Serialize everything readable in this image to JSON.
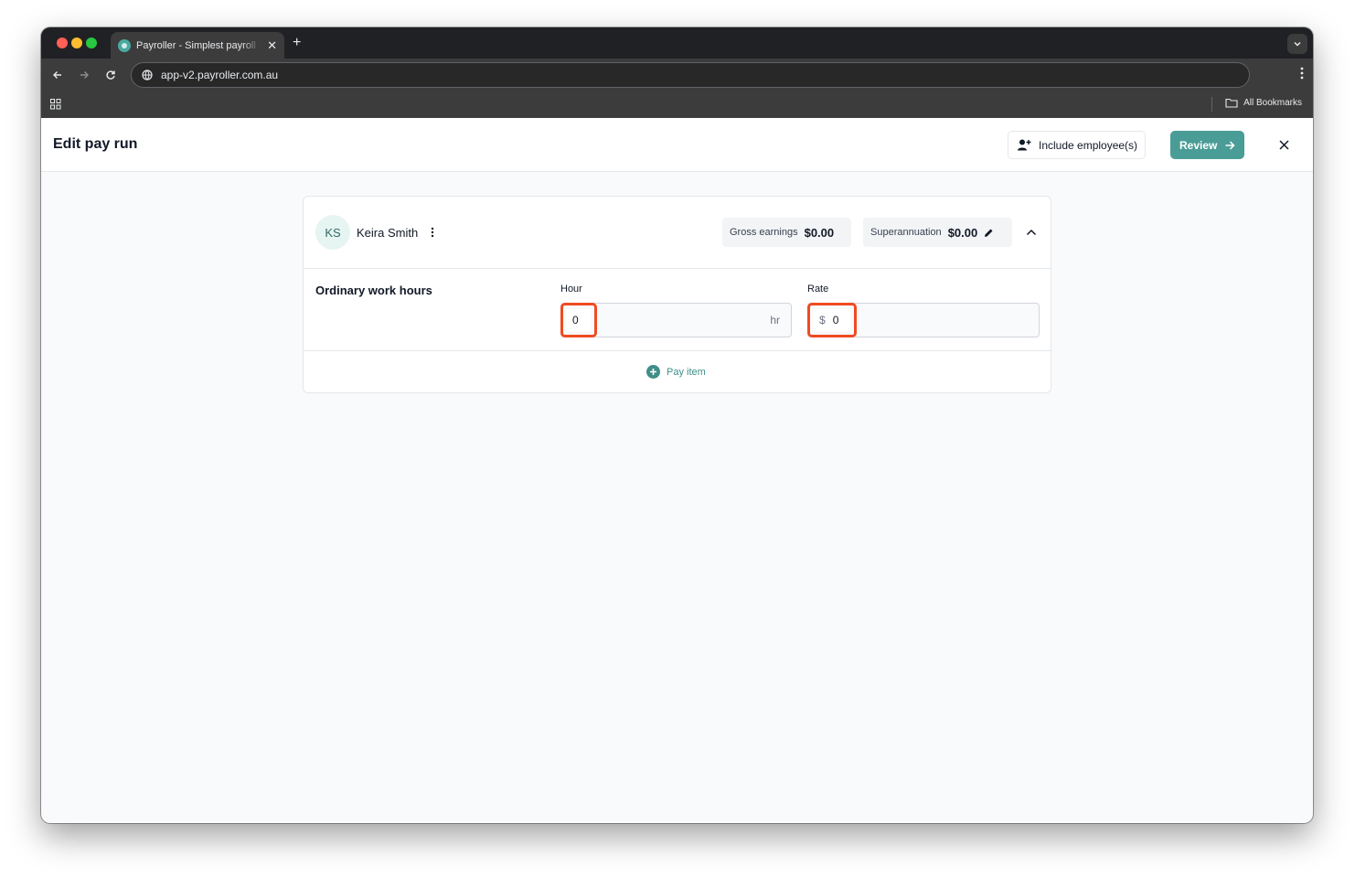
{
  "browser": {
    "tab_title": "Payroller - Simplest payroll software",
    "new_tab": "+",
    "url": "app-v2.payroller.com.au",
    "bookmarks_label": "All Bookmarks"
  },
  "header": {
    "title": "Edit pay run",
    "include_label": "Include employee(s)",
    "review_label": "Review"
  },
  "employee": {
    "initials": "KS",
    "name": "Keira Smith",
    "gross_label": "Gross earnings",
    "gross_value": "$0.00",
    "super_label": "Superannuation",
    "super_value": "$0.00"
  },
  "pay_rows": [
    {
      "title": "Ordinary work hours",
      "hour_label": "Hour",
      "hour_value": "0",
      "hour_unit": "hr",
      "rate_label": "Rate",
      "rate_currency": "$",
      "rate_value": "0"
    }
  ],
  "actions": {
    "pay_item_label": "Pay item"
  },
  "colors": {
    "accent": "#4a9d96",
    "highlight": "#f04a23"
  }
}
